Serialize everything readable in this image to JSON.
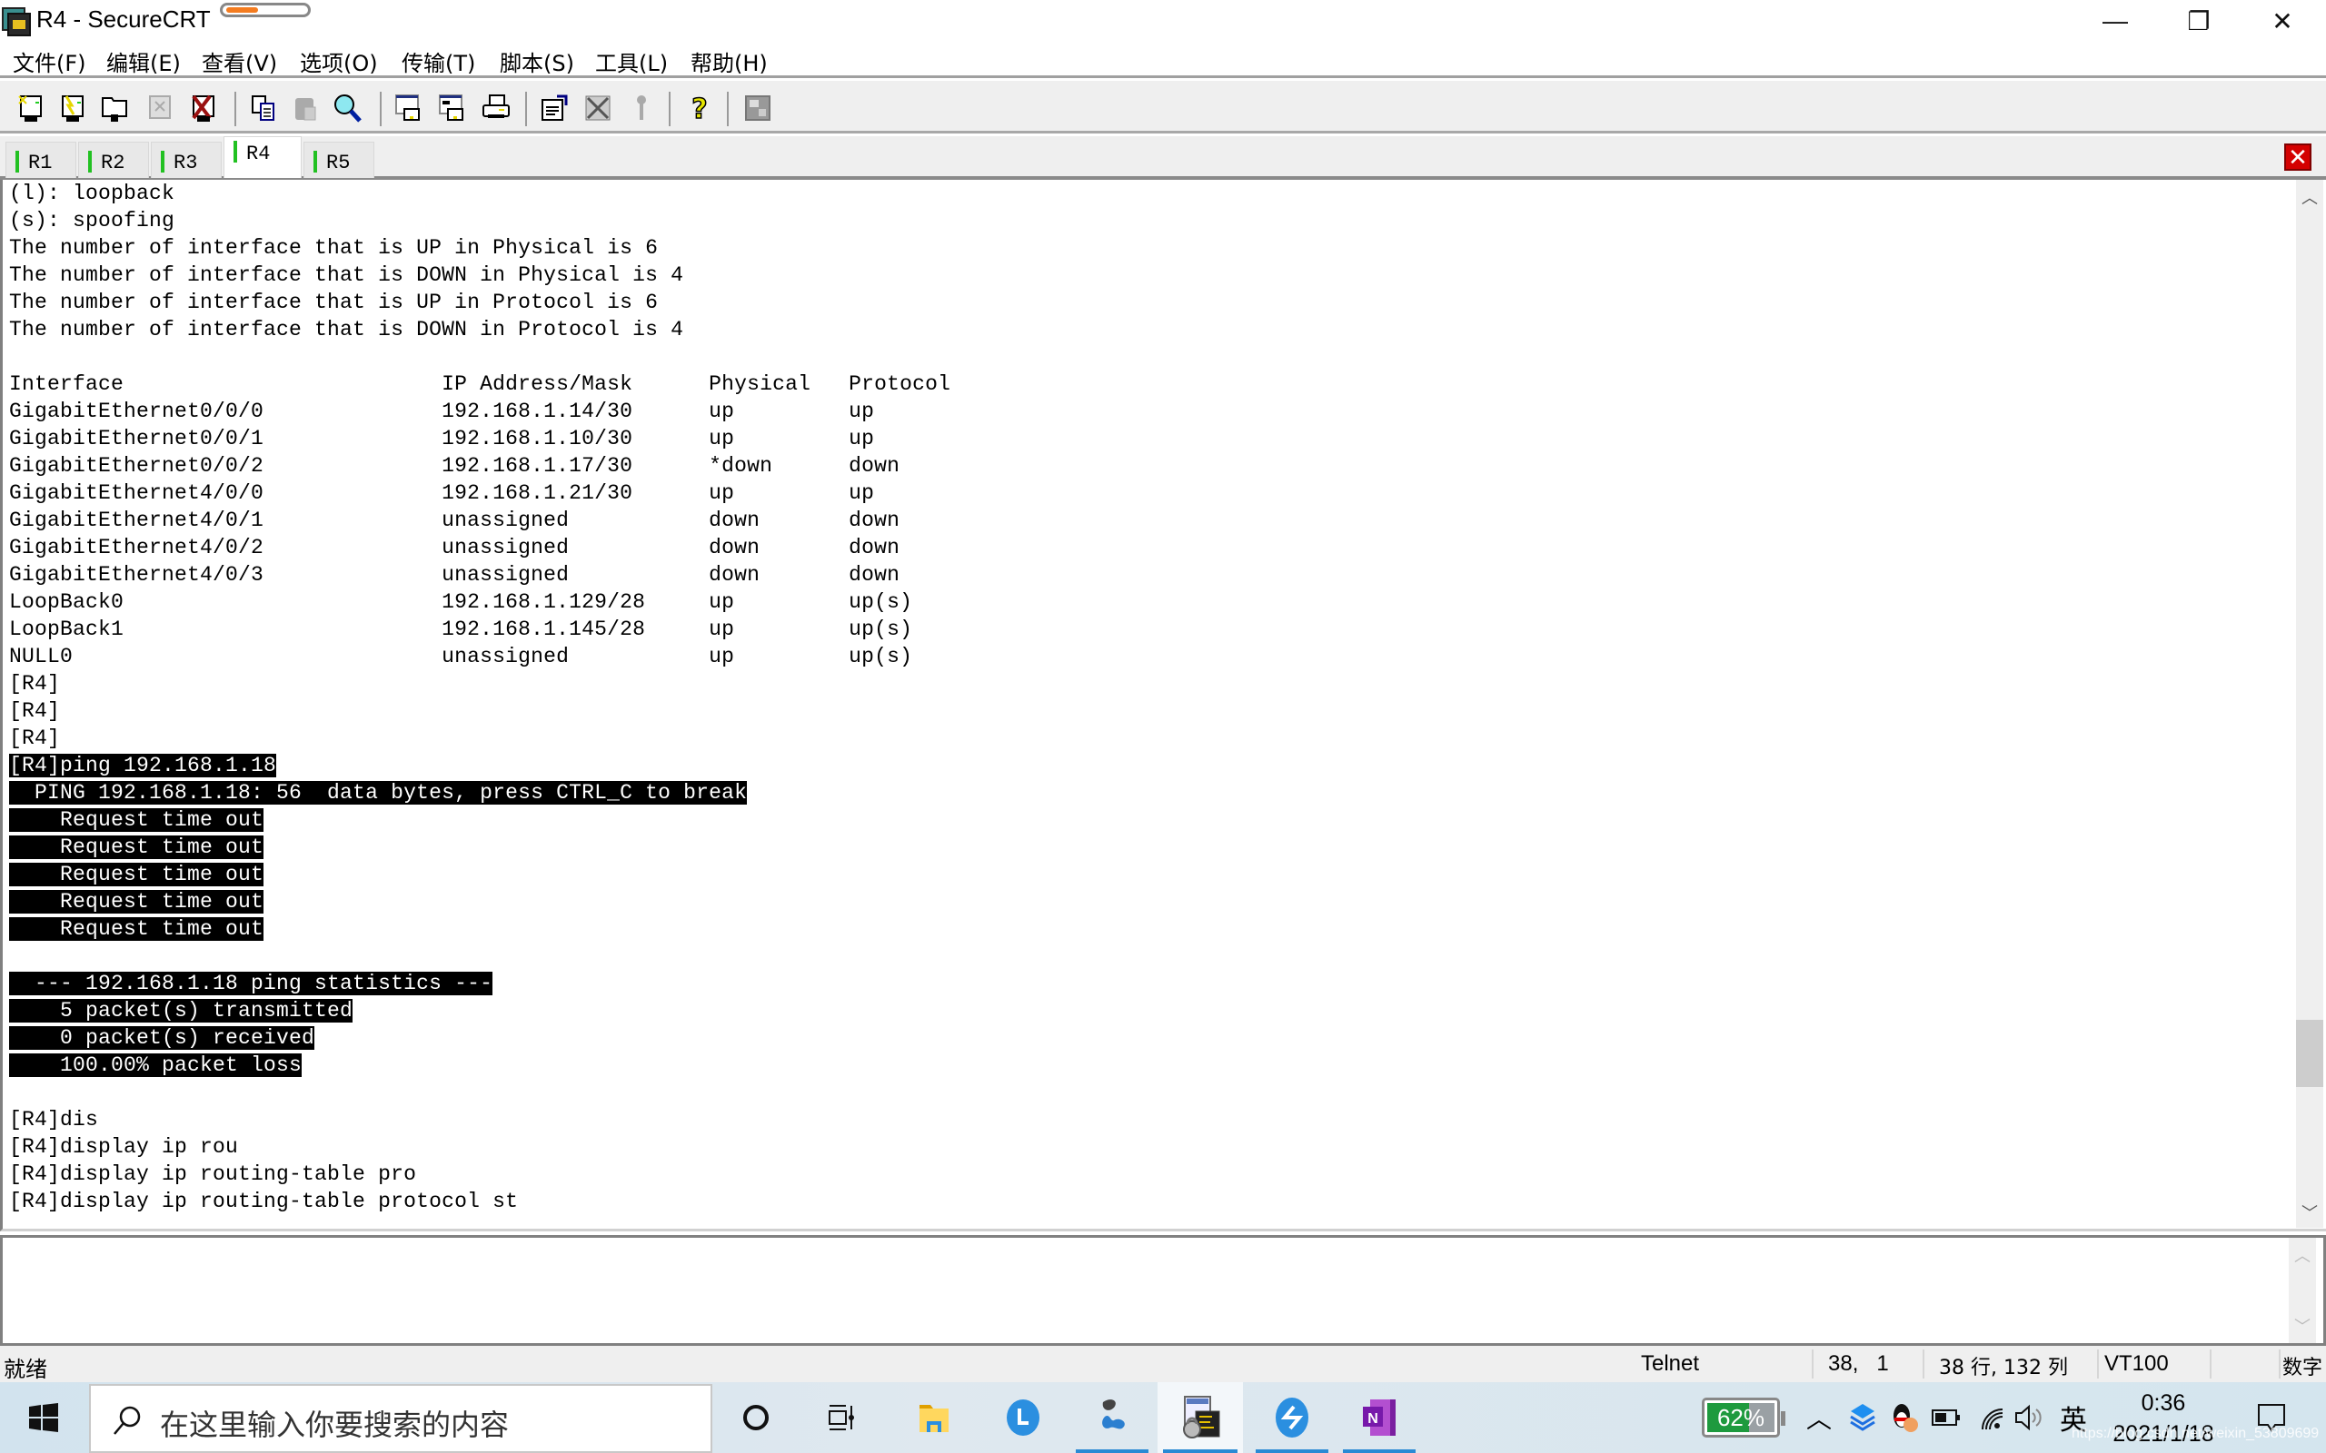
{
  "window": {
    "title": "R4 - SecureCRT",
    "title_progress_fraction": 0.4,
    "controls": {
      "minimize": "—",
      "restore": "❐",
      "close": "✕"
    }
  },
  "menu": [
    "文件(F)",
    "编辑(E)",
    "查看(V)",
    "选项(O)",
    "传输(T)",
    "脚本(S)",
    "工具(L)",
    "帮助(H)"
  ],
  "toolbar": [
    {
      "icon": "connect-icon"
    },
    {
      "icon": "quick-connect-icon"
    },
    {
      "icon": "connect-in-tab-icon"
    },
    {
      "icon": "reconnect-icon",
      "disabled": true
    },
    {
      "icon": "disconnect-icon"
    },
    {
      "sep": true
    },
    {
      "icon": "copy-icon"
    },
    {
      "icon": "paste-icon",
      "disabled": true
    },
    {
      "icon": "find-icon"
    },
    {
      "sep": true
    },
    {
      "icon": "print-screen-icon"
    },
    {
      "icon": "print-selection-icon"
    },
    {
      "icon": "printer-icon"
    },
    {
      "sep": true
    },
    {
      "icon": "session-options-icon"
    },
    {
      "icon": "global-options-icon"
    },
    {
      "icon": "keymap-icon",
      "disabled": true
    },
    {
      "sep": true
    },
    {
      "icon": "help-icon"
    },
    {
      "sep": true
    },
    {
      "icon": "sftp-icon",
      "disabled": true
    }
  ],
  "tabs": [
    {
      "label": "R1",
      "active": false
    },
    {
      "label": "R2",
      "active": false
    },
    {
      "label": "R3",
      "active": false
    },
    {
      "label": "R4",
      "active": true
    },
    {
      "label": "R5",
      "active": false
    }
  ],
  "terminal": {
    "lines": [
      {
        "text": "(l): loopback"
      },
      {
        "text": "(s): spoofing"
      },
      {
        "text": "The number of interface that is UP in Physical is 6"
      },
      {
        "text": "The number of interface that is DOWN in Physical is 4"
      },
      {
        "text": "The number of interface that is UP in Protocol is 6"
      },
      {
        "text": "The number of interface that is DOWN in Protocol is 4"
      },
      {
        "text": ""
      },
      {
        "text": "Interface                         IP Address/Mask      Physical   Protocol"
      },
      {
        "text": "GigabitEthernet0/0/0              192.168.1.14/30      up         up"
      },
      {
        "text": "GigabitEthernet0/0/1              192.168.1.10/30      up         up"
      },
      {
        "text": "GigabitEthernet0/0/2              192.168.1.17/30      *down      down"
      },
      {
        "text": "GigabitEthernet4/0/0              192.168.1.21/30      up         up"
      },
      {
        "text": "GigabitEthernet4/0/1              unassigned           down       down"
      },
      {
        "text": "GigabitEthernet4/0/2              unassigned           down       down"
      },
      {
        "text": "GigabitEthernet4/0/3              unassigned           down       down"
      },
      {
        "text": "LoopBack0                         192.168.1.129/28     up         up(s)"
      },
      {
        "text": "LoopBack1                         192.168.1.145/28     up         up(s)"
      },
      {
        "text": "NULL0                             unassigned           up         up(s)"
      },
      {
        "text": "[R4]"
      },
      {
        "text": "[R4]"
      },
      {
        "text": "[R4]"
      },
      {
        "text": "[R4]ping 192.168.1.18",
        "selected": true
      },
      {
        "text": "  PING 192.168.1.18: 56  data bytes, press CTRL_C to break",
        "selected": true
      },
      {
        "text": "    Request time out",
        "selected": true
      },
      {
        "text": "    Request time out",
        "selected": true
      },
      {
        "text": "    Request time out",
        "selected": true
      },
      {
        "text": "    Request time out",
        "selected": true
      },
      {
        "text": "    Request time out",
        "selected": true
      },
      {
        "text": ""
      },
      {
        "text": "  --- 192.168.1.18 ping statistics ---",
        "selected": true
      },
      {
        "text": "    5 packet(s) transmitted",
        "selected": true
      },
      {
        "text": "    0 packet(s) received",
        "selected": true
      },
      {
        "text": "    100.00% packet loss",
        "selected": true
      },
      {
        "text": ""
      },
      {
        "text": "[R4]dis"
      },
      {
        "text": "[R4]display ip rou"
      },
      {
        "text": "[R4]display ip routing-table pro"
      },
      {
        "text": "[R4]display ip routing-table protocol st"
      }
    ],
    "scroll_position_fraction": 0.88
  },
  "input_pane": {
    "value": ""
  },
  "statusbar": {
    "ready": "就绪",
    "protocol": "Telnet",
    "cursor": "38,   1",
    "size": "38 行, 132 列",
    "emulation": "VT100",
    "numlock": "数字"
  },
  "taskbar": {
    "search_placeholder": "在这里输入你要搜索的内容",
    "apps": [
      {
        "icon": "cortana-icon"
      },
      {
        "icon": "task-view-icon"
      },
      {
        "icon": "file-explorer-icon"
      },
      {
        "icon": "app-l-icon"
      },
      {
        "icon": "eve-ng-icon",
        "running": true
      },
      {
        "icon": "securecrt-icon",
        "running": true,
        "active": true
      },
      {
        "icon": "feishu-icon",
        "running": true
      },
      {
        "icon": "onenote-icon",
        "running": true
      }
    ],
    "battery_percent": "62%",
    "ime": "英",
    "time": "0:36",
    "date": "2021/1/18",
    "watermark": "https://blog.csdn.net/weixin_53809699"
  },
  "colors": {
    "tab_indicator": "#22c122",
    "selection_bg": "#000000",
    "selection_fg": "#ffffff",
    "taskbar_accent": "#2a8ad4",
    "battery_green": "#1e9a3e"
  }
}
